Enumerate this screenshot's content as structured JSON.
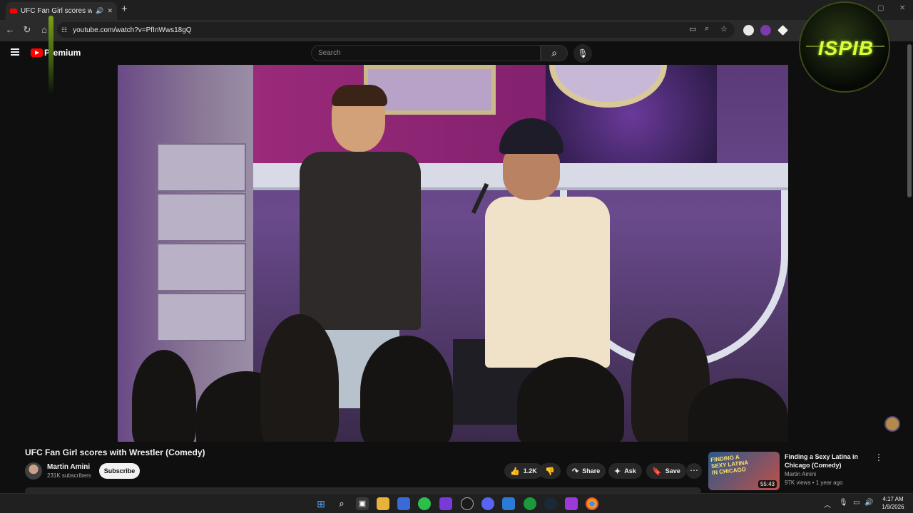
{
  "browser": {
    "tab_title": "UFC Fan Girl scores with W",
    "tab_audio_icon": "speaker-icon",
    "tab_close_glyph": "✕",
    "new_tab_glyph": "+",
    "url": "youtube.com/watch?v=PfInWws18gQ",
    "window_min": "—",
    "window_max": "▢",
    "window_close": "✕"
  },
  "youtube": {
    "brand": "Premium",
    "search_placeholder": "Search"
  },
  "video": {
    "title": "UFC Fan Girl scores with Wrestler (Comedy)",
    "channel": "Martin Amini",
    "subscribers": "231K subscribers",
    "subscribe_label": "Subscribe",
    "likes": "1.2K",
    "share_label": "Share",
    "ask_label": "Ask",
    "save_label": "Save"
  },
  "recommendation": {
    "thumb_text": "FINDING A SEXY LATINA IN CHICAGO",
    "duration": "55:43",
    "title": "Finding a Sexy Latina in Chicago (Comedy)",
    "channel": "Martin Amini",
    "meta": "97K views • 1 year ago"
  },
  "overlay": {
    "logo_text": "ISPIB"
  },
  "taskbar": {
    "time": "4:17 AM",
    "date": "1/9/2026"
  },
  "colors": {
    "background": "#0f0f0f",
    "youtube_red": "#ff0000",
    "chip": "#272727",
    "logo_green": "#d8ff3a"
  }
}
